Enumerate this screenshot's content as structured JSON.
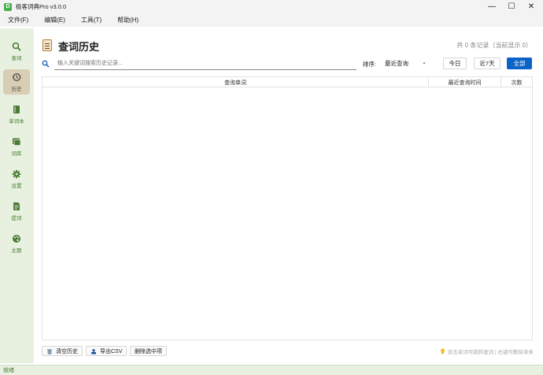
{
  "window": {
    "title": "极客词典Pro v3.0.0",
    "app_icon_letter": "D",
    "minimize": "—",
    "maximize": "☐",
    "close": "✕"
  },
  "menu": [
    "文件(F)",
    "编辑(E)",
    "工具(T)",
    "帮助(H)"
  ],
  "sidebar": {
    "items": [
      {
        "label": "查词",
        "icon": "search-icon"
      },
      {
        "label": "历史",
        "icon": "history-icon",
        "active": true
      },
      {
        "label": "单词本",
        "icon": "book-icon"
      },
      {
        "label": "词库",
        "icon": "library-icon"
      },
      {
        "label": "设置",
        "icon": "gear-icon"
      },
      {
        "label": "提词",
        "icon": "note-icon"
      },
      {
        "label": "主题",
        "icon": "palette-icon"
      }
    ]
  },
  "page": {
    "title": "查词历史",
    "record_count": "共 0 条记录（当前显示 0）"
  },
  "search": {
    "placeholder": "输入关键词搜索历史记录..."
  },
  "sort": {
    "label": "排序:",
    "selected": "最近查询"
  },
  "filters": {
    "today": "今日",
    "last7": "近7天",
    "all": "全部"
  },
  "table": {
    "columns": [
      "查询单词",
      "最近查询时间",
      "次数"
    ],
    "rows": []
  },
  "actions": {
    "clear": "清空历史",
    "export": "导出CSV",
    "delete_selected": "删除选中项"
  },
  "hint": "双击单词可跳转查词 | 右键可删除单条",
  "status": "就绪",
  "colors": {
    "accent": "#0a63c6",
    "sidebar_bg": "#e8f1e0",
    "nav_green": "#4a7c35",
    "active_bg": "#d8cdb5"
  }
}
